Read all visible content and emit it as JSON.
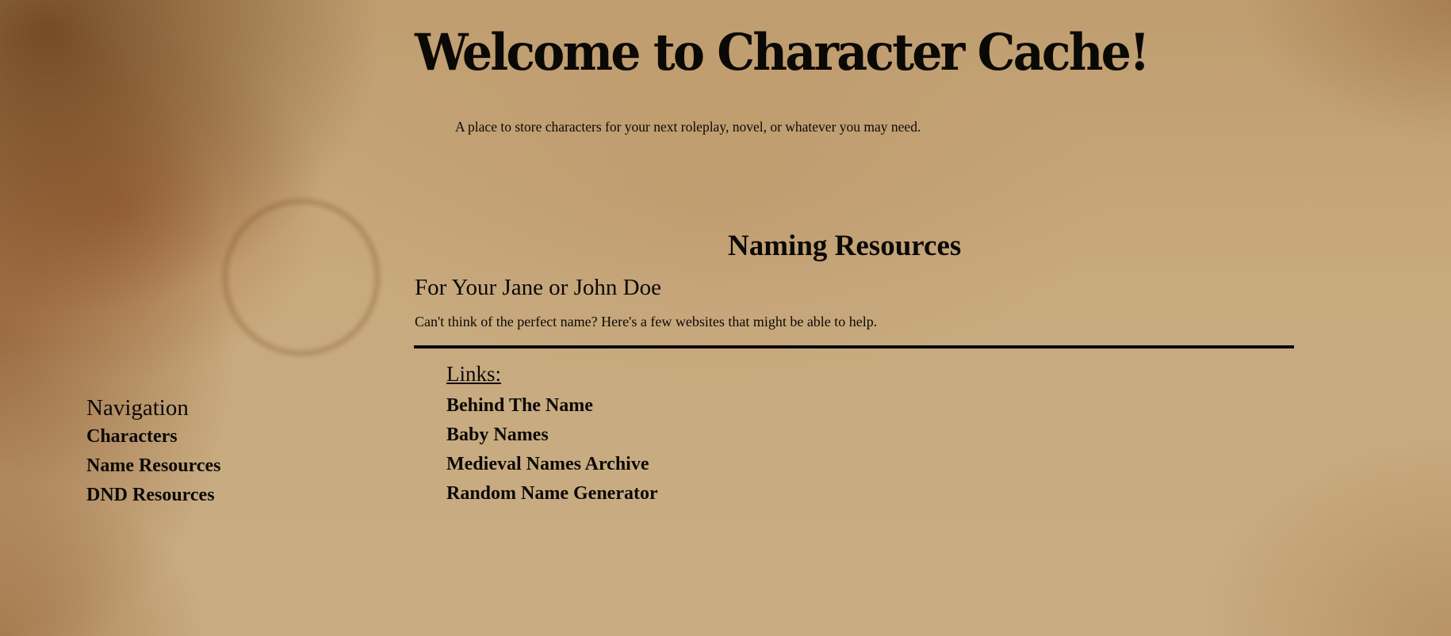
{
  "header": {
    "title": "Welcome to Character Cache!",
    "tagline": "A place to store characters for your next roleplay, novel, or whatever you may need."
  },
  "navigation": {
    "title": "Navigation",
    "items": [
      {
        "label": "Characters"
      },
      {
        "label": "Name Resources"
      },
      {
        "label": "DND Resources"
      }
    ]
  },
  "main": {
    "heading": "Naming Resources",
    "subheading": "For Your Jane or John Doe",
    "intro": "Can't think of the perfect name? Here's a few websites that might be able to help.",
    "links_heading": "Links:",
    "links": [
      {
        "label": "Behind The Name"
      },
      {
        "label": "Baby Names"
      },
      {
        "label": "Medieval Names Archive"
      },
      {
        "label": "Random Name Generator"
      }
    ]
  },
  "colors": {
    "text": "#0b0906",
    "parchment": "#c4a67a",
    "stain": "#5c300e"
  }
}
